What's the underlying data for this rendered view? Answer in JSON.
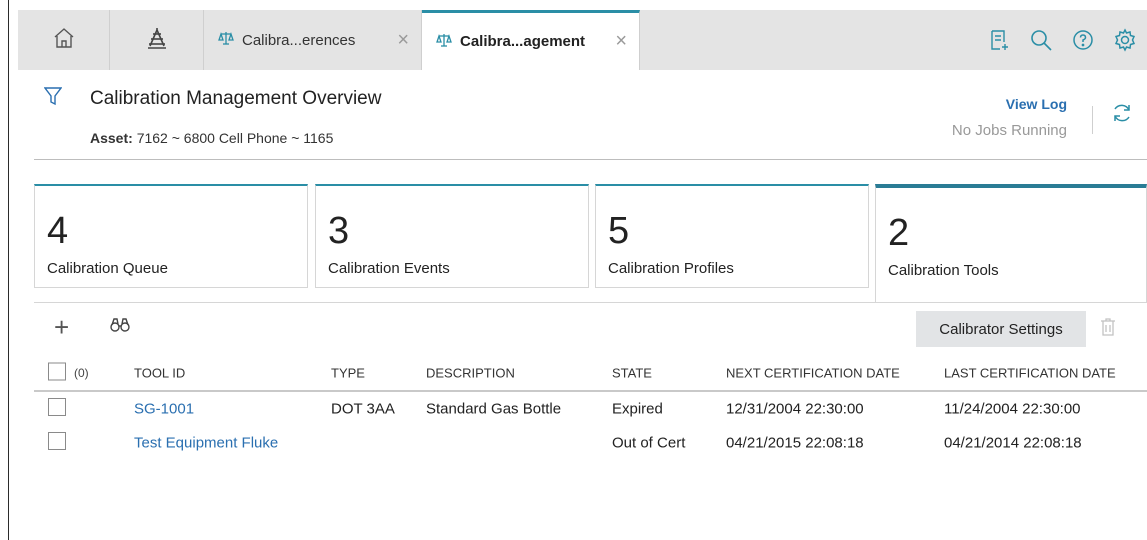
{
  "tabs": [
    {
      "label": "Calibra...erences",
      "active": false
    },
    {
      "label": "Calibra...agement",
      "active": true
    }
  ],
  "header": {
    "title": "Calibration Management Overview",
    "asset_label": "Asset:",
    "asset_value": "7162 ~ 6800 Cell Phone ~ 1165",
    "view_log": "View Log",
    "jobs_status": "No Jobs Running"
  },
  "cards": [
    {
      "count": "4",
      "label": "Calibration Queue",
      "active": false
    },
    {
      "count": "3",
      "label": "Calibration Events",
      "active": false
    },
    {
      "count": "5",
      "label": "Calibration Profiles",
      "active": false
    },
    {
      "count": "2",
      "label": "Calibration Tools",
      "active": true
    }
  ],
  "toolbar": {
    "settings_label": "Calibrator Settings"
  },
  "table": {
    "selected_count": "(0)",
    "columns": [
      "TOOL ID",
      "TYPE",
      "DESCRIPTION",
      "STATE",
      "NEXT CERTIFICATION DATE",
      "LAST CERTIFICATION DATE"
    ],
    "rows": [
      {
        "tool_id": "SG-1001",
        "type": "DOT 3AA",
        "description": "Standard Gas Bottle",
        "state": "Expired",
        "next_cert": "12/31/2004 22:30:00",
        "last_cert": "11/24/2004 22:30:00"
      },
      {
        "tool_id": "Test Equipment Fluke",
        "type": "",
        "description": "",
        "state": "Out of Cert",
        "next_cert": "04/21/2015 22:08:18",
        "last_cert": "04/21/2014 22:08:18"
      }
    ]
  },
  "colors": {
    "accent": "#2a8ea6",
    "link": "#2a6fb0",
    "tab_bar": "#e4e4e4"
  },
  "icons": [
    "home-icon",
    "hierarchy-icon",
    "scale-icon",
    "close-icon",
    "new-record-icon",
    "search-icon",
    "help-icon",
    "gear-icon",
    "filter-icon",
    "refresh-icon",
    "plus-icon",
    "binoculars-icon",
    "trash-icon"
  ]
}
